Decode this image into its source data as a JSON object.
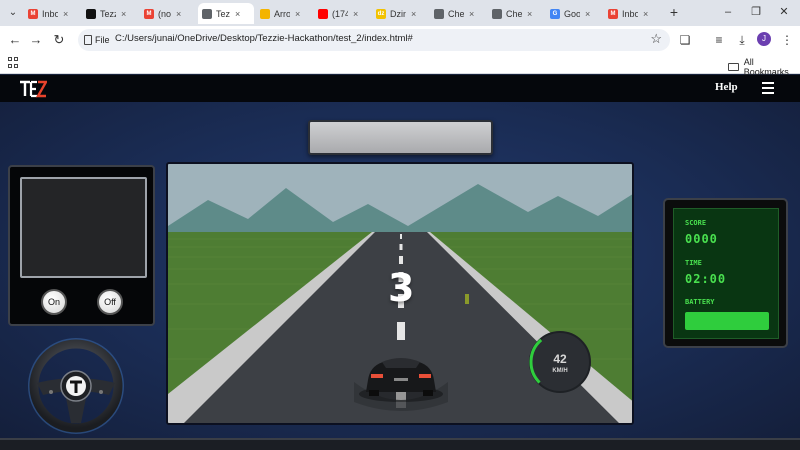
{
  "browser": {
    "tabs": [
      {
        "title": "Inbo",
        "icon": "gmail-icon",
        "color": "#ea4335",
        "letter": "M"
      },
      {
        "title": "Tezz",
        "icon": "github-icon",
        "color": "#111111",
        "letter": ""
      },
      {
        "title": "(no",
        "icon": "gmail-icon",
        "color": "#ea4335",
        "letter": "M"
      },
      {
        "title": "Tez",
        "icon": "globe-icon",
        "color": "#5f6368",
        "letter": "",
        "active": true
      },
      {
        "title": "Arro",
        "icon": "emoji-icon",
        "color": "#f4b400",
        "letter": ""
      },
      {
        "title": "(174",
        "icon": "youtube-icon",
        "color": "#ff0000",
        "letter": ""
      },
      {
        "title": "Dzin",
        "icon": "dz-icon",
        "color": "#f2c200",
        "letter": "dz"
      },
      {
        "title": "Che",
        "icon": "globe-icon",
        "color": "#5f6368",
        "letter": ""
      },
      {
        "title": "Che",
        "icon": "globe-icon",
        "color": "#5f6368",
        "letter": ""
      },
      {
        "title": "Goo",
        "icon": "google-icon",
        "color": "#4285f4",
        "letter": "G"
      },
      {
        "title": "Inbo",
        "icon": "gmail-icon",
        "color": "#ea4335",
        "letter": "M"
      }
    ],
    "address": {
      "scheme_label": "File",
      "url": "C:/Users/junai/OneDrive/Desktop/Tezzie-Hackathon/test_2/index.html#"
    },
    "profile_initial": "J",
    "bookmarks_label": "All Bookmarks"
  },
  "header": {
    "help_label": "Help"
  },
  "game": {
    "countdown": "3",
    "speed_value": "42",
    "speed_unit": "KM/H",
    "speed_fraction": 0.35
  },
  "camera": {
    "on_label": "On",
    "off_label": "Off"
  },
  "stats": {
    "score_label": "SCORE",
    "score_value": "0000",
    "time_label": "TIME",
    "time_value": "02:00",
    "battery_label": "BATTERY",
    "battery_level": 1.0
  },
  "colors": {
    "hud_green": "#49e04f",
    "sky": "#9fb3bb",
    "grass": "#4e7d33"
  }
}
